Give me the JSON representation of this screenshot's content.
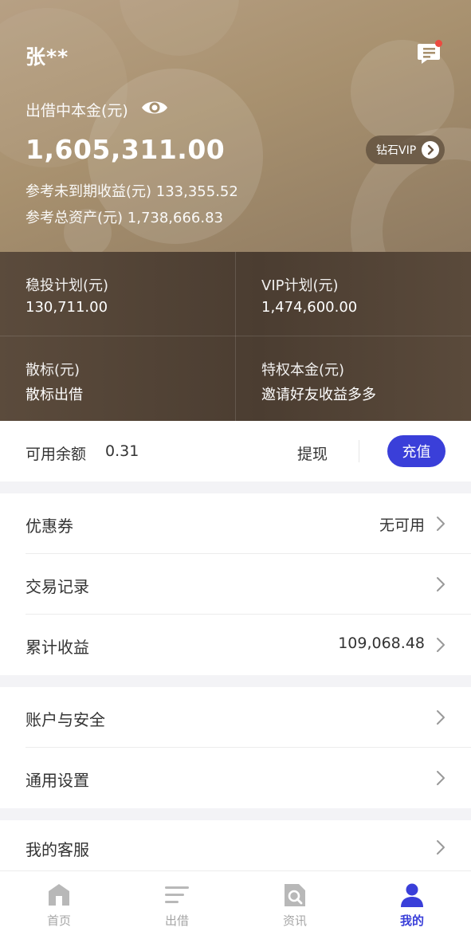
{
  "user": {
    "name": "张**"
  },
  "principal": {
    "label": "出借中本金(元)",
    "value": "1,605,311.00",
    "expected_income": "参考未到期收益(元) 133,355.52",
    "total_assets": "参考总资产(元) 1,738,666.83"
  },
  "vip_badge": {
    "label": "钻石VIP"
  },
  "plans": [
    {
      "title": "稳投计划(元)",
      "value": "130,711.00"
    },
    {
      "title": "VIP计划(元)",
      "value": "1,474,600.00"
    },
    {
      "title": "散标(元)",
      "value": "散标出借"
    },
    {
      "title": "特权本金(元)",
      "value": "邀请好友收益多多"
    }
  ],
  "balance": {
    "label": "可用余额",
    "value": "0.31",
    "withdraw": "提现",
    "recharge": "充值"
  },
  "menu": {
    "coupon": {
      "label": "优惠券",
      "value": "无可用"
    },
    "transactions": {
      "label": "交易记录"
    },
    "cumulative": {
      "label": "累计收益",
      "value": "109,068.48"
    },
    "security": {
      "label": "账户与安全"
    },
    "settings": {
      "label": "通用设置"
    },
    "service": {
      "label": "我的客服"
    }
  },
  "tabs": [
    {
      "label": "首页",
      "icon": "home-icon"
    },
    {
      "label": "出借",
      "icon": "list-icon"
    },
    {
      "label": "资讯",
      "icon": "news-search-icon"
    },
    {
      "label": "我的",
      "icon": "profile-icon",
      "active": true
    }
  ],
  "colors": {
    "accent": "#3a3fd9",
    "header_gold": "#a8916f",
    "plan_dark": "#4b3d31",
    "notification_dot": "#ec4a3f"
  }
}
